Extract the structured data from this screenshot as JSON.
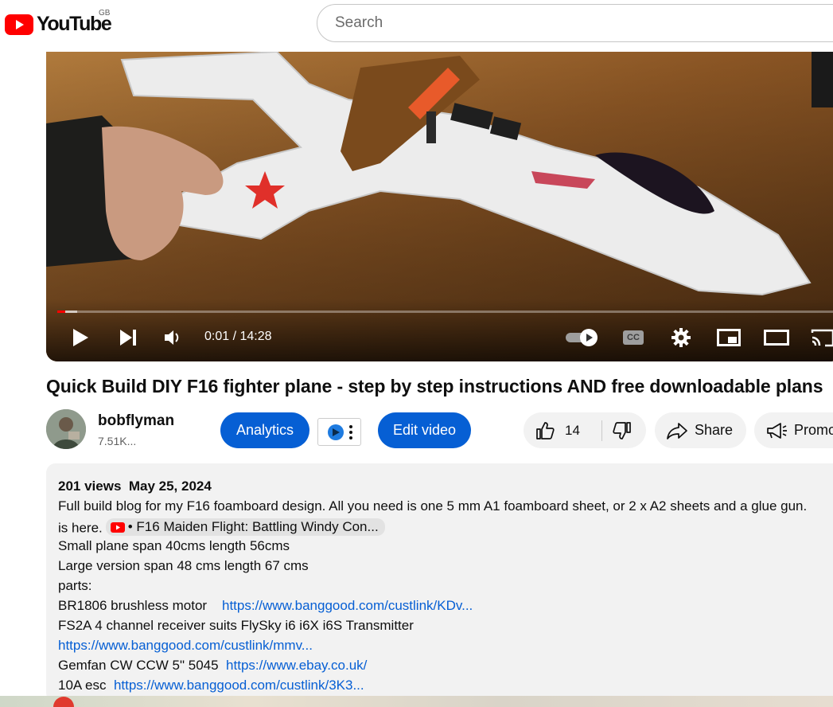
{
  "header": {
    "logo_text": "YouTube",
    "country_code": "GB",
    "search_placeholder": "Search"
  },
  "player": {
    "time_current": "0:01",
    "time_separator": " / ",
    "time_total": "14:28",
    "progress_fraction": 0.01,
    "buffer_fraction": 0.025,
    "cc_label": "CC"
  },
  "video": {
    "title": "Quick Build DIY F16 fighter plane - step by step instructions AND free downloadable plans"
  },
  "channel": {
    "name": "bobflyman",
    "subscribers": "7.51K..."
  },
  "actions": {
    "analytics_label": "Analytics",
    "edit_label": "Edit video",
    "likes": "14",
    "share_label": "Share",
    "promote_label": "Promote"
  },
  "description": {
    "views": "201 views",
    "date": "May 25, 2024",
    "lines": [
      "Full build blog for my F16  foamboard design.  All you need is one 5 mm  A1 foamboard sheet, or 2 x A2 sheets and a glue gun.",
      "is here.",
      "Small plane span 40cms  length 56cms",
      "Large version span 48 cms length 67 cms",
      "parts:",
      "BR1806 brushless motor",
      "FS2A  4 channel receiver suits FlySky i6 i6X i6S Transmitter",
      "Gemfan CW CCW 5\" 5045",
      "10A esc"
    ],
    "chip_text": "• F16 Maiden Flight: Battling Windy Con...",
    "links": {
      "motor": "https://www.banggood.com/custlink/KDv...",
      "receiver": "https://www.banggood.com/custlink/mmv...",
      "prop": "https://www.ebay.co.uk/",
      "esc": "https://www.banggood.com/custlink/3K3..."
    }
  },
  "colors": {
    "brand_red": "#ff0000",
    "action_blue": "#065fd4",
    "link_blue": "#065fd4",
    "pill_bg": "#f2f2f2"
  }
}
